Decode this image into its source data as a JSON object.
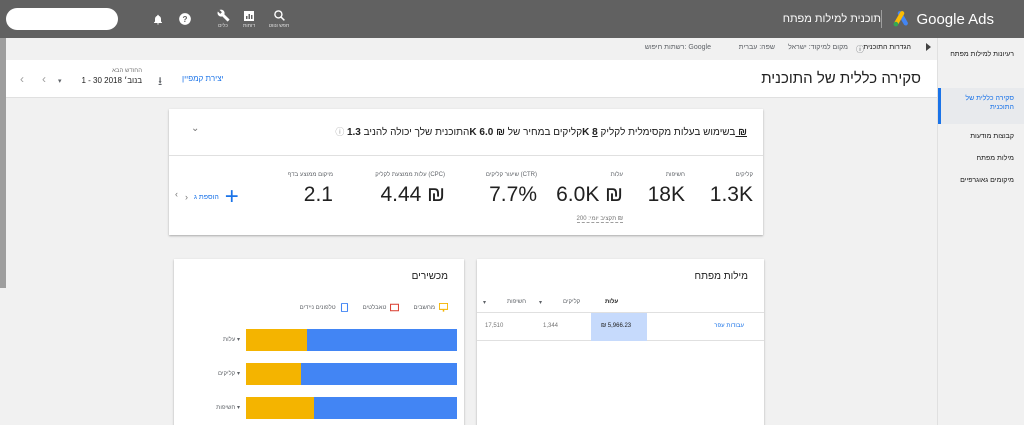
{
  "topbar": {
    "app_name": "Google Ads",
    "plan_title": "תוכנית למילות מפתח",
    "icons": [
      {
        "name": "search-icon",
        "label": "חפש ונווט"
      },
      {
        "name": "reports-icon",
        "label": "דוחות"
      },
      {
        "name": "tools-icon",
        "label": "כלים"
      },
      {
        "name": "help-icon",
        "label": ""
      },
      {
        "name": "bell-icon",
        "label": ""
      }
    ]
  },
  "breadcrumb": {
    "plan_settings": "הגדרות התוכנית",
    "location": "מקום למיקוד: ישראל",
    "language": "שפה: עברית",
    "network": "רשתות חיפוש: Google"
  },
  "header": {
    "title": "סקירה כללית של התוכנית",
    "create_campaign": "יצירת קמפיין",
    "date_label": "החודש הבא",
    "date_value": "1 - 30 בנוב׳ 2018"
  },
  "sidebar": {
    "items": [
      {
        "label": "רעיונות למילות מפתח"
      },
      {
        "label": "סקירה כללית של התוכנית"
      },
      {
        "label": "קבוצות מודעות"
      },
      {
        "label": "מילות מפתח"
      },
      {
        "label": "מיקומים גאוגרפיים"
      }
    ]
  },
  "summary": {
    "statement_pre": "התוכנית שלך יכולה להניב",
    "clicks_value": "1.3K",
    "statement_mid1": "קליקים במחיר של",
    "cost_value": "₪ 6.0K",
    "statement_mid2": "בשימוש בעלות מקסימלית לקליק",
    "max_cpc": "8 ₪",
    "metrics": [
      {
        "label": "קליקים",
        "value": "1.3K",
        "sub": ""
      },
      {
        "label": "חשיפות",
        "value": "18K",
        "sub": ""
      },
      {
        "label": "עלות",
        "value": "6.0K ₪",
        "sub": "תקציב יומי: 200 ₪"
      },
      {
        "label": "שיעור קליקים (CTR)",
        "value": "7.7%",
        "sub": ""
      },
      {
        "label": "עלות ממוצעת לקליק (CPC)",
        "value": "4.44 ₪",
        "sub": ""
      },
      {
        "label": "מיקום ממוצע בדף",
        "value": "2.1",
        "sub": ""
      }
    ],
    "add_label": "הוספת ג"
  },
  "devices": {
    "title": "מכשירים",
    "legend": [
      {
        "label": "טלפונים ניידים",
        "color": "#4285f4",
        "icon": "mobile-icon"
      },
      {
        "label": "טאבלטים",
        "color": "#db4437",
        "icon": "tablet-icon"
      },
      {
        "label": "מחשבים",
        "color": "#f4b400",
        "icon": "computer-icon"
      }
    ],
    "rows": [
      {
        "label": "עלות",
        "mobile": 0.71,
        "tablet": 0.0,
        "computer": 0.29
      },
      {
        "label": "קליקים",
        "mobile": 0.74,
        "tablet": 0.0,
        "computer": 0.26
      },
      {
        "label": "חשיפות",
        "mobile": 0.68,
        "tablet": 0.0,
        "computer": 0.32
      }
    ]
  },
  "keywords": {
    "title": "מילות מפתח",
    "columns": [
      "עלות",
      "קליקים",
      "חשיפות"
    ],
    "rows": [
      {
        "keyword": "עבודות עפר",
        "cost": "₪ 5,966.23",
        "clicks": "1,344",
        "impressions": "17,510"
      }
    ]
  },
  "colors": {
    "accent": "#1a73e8",
    "topbar": "#616161",
    "mobile": "#4285f4",
    "computer": "#f4b400",
    "tablet": "#db4437"
  }
}
